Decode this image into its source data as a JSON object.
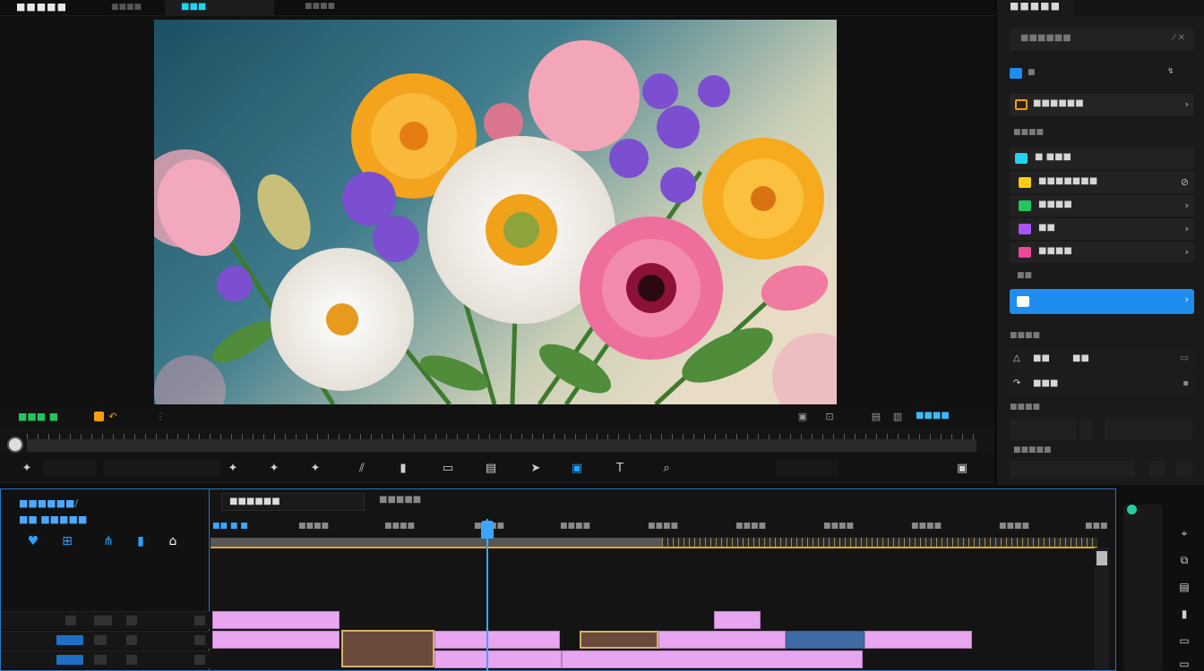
{
  "header": {
    "app_title": "■■■■■",
    "muted_label": "■■■■",
    "tab_active": "■■■",
    "tab_inactive": "■■■■"
  },
  "player": {
    "left_label": "■■■ ■",
    "left_label_color": "#22c55e",
    "right_label": "■■■■",
    "right_label_color": "#38bdf8",
    "icons": [
      "color-chip-icon",
      "undo-icon",
      "settings-icon",
      "fullscreen-icon",
      "export-icon",
      "fit-icon"
    ]
  },
  "toolbar": {
    "icons": [
      "marker-icon",
      "split-icon",
      "crop-icon",
      "mask-icon",
      "speed-icon",
      "text-icon",
      "search-icon",
      "save-icon"
    ]
  },
  "right_panel": {
    "title": "■■■■■",
    "search_placeholder": "■■■■■■",
    "section_label": "■",
    "active_item": "■■■■■■",
    "subsection": "■■■■",
    "items": [
      {
        "label": "■ ■■■",
        "color": "#22d3ee"
      },
      {
        "label": "■■■■■■■",
        "color": "#facc15"
      },
      {
        "label": "■■■■",
        "color": "#22c55e"
      },
      {
        "label": "■■",
        "color": "#a855f7"
      },
      {
        "label": "■■■■",
        "color": "#ec4899"
      }
    ],
    "section2": "■■",
    "selected_label": "",
    "group_label": "■■■■",
    "rows": [
      "■■",
      "■■",
      "■■■"
    ],
    "row2_label": "■■■",
    "section3": "■■■■",
    "section4": "■■■■■"
  },
  "timeline": {
    "project_line1": "■■■■■■/",
    "project_line2": "■■ ■■■■■",
    "sequence_tab": "■■■■■■",
    "sequence_tab2": "■■■■■",
    "ruler_labels": [
      "■■ ■ ■",
      "■■■■",
      "■■■■",
      "■■■■",
      "■■■■",
      "■■■■",
      "■■■■",
      "■■■■",
      "■■■■",
      "■■■■",
      "■■■"
    ],
    "accent": "#2e74c5",
    "clip_color": "#e7a6ef",
    "playhead_color": "#3ba6ff"
  }
}
